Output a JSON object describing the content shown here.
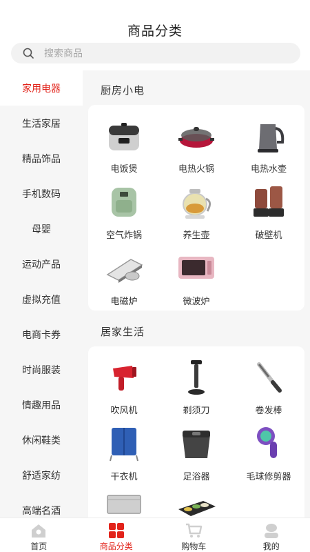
{
  "header": {
    "title": "商品分类"
  },
  "search": {
    "placeholder": "搜索商品"
  },
  "sidebar": {
    "items": [
      {
        "label": "家用电器",
        "active": true
      },
      {
        "label": "生活家居"
      },
      {
        "label": "精品饰品"
      },
      {
        "label": "手机数码"
      },
      {
        "label": "母婴"
      },
      {
        "label": "运动产品"
      },
      {
        "label": "虚拟充值"
      },
      {
        "label": "电商卡券"
      },
      {
        "label": "时尚服装"
      },
      {
        "label": "情趣用品"
      },
      {
        "label": "休闲鞋类"
      },
      {
        "label": "舒适家纺"
      },
      {
        "label": "高端名酒"
      }
    ]
  },
  "sections": [
    {
      "title": "厨房小电",
      "items": [
        {
          "label": "电饭煲",
          "icon": "rice-cooker-icon"
        },
        {
          "label": "电热火锅",
          "icon": "hotpot-icon"
        },
        {
          "label": "电热水壶",
          "icon": "kettle-icon"
        },
        {
          "label": "空气炸锅",
          "icon": "air-fryer-icon"
        },
        {
          "label": "养生壶",
          "icon": "health-pot-icon"
        },
        {
          "label": "破壁机",
          "icon": "blender-icon"
        },
        {
          "label": "电磁炉",
          "icon": "induction-cooker-icon"
        },
        {
          "label": "微波炉",
          "icon": "microwave-icon"
        }
      ]
    },
    {
      "title": "居家生活",
      "items": [
        {
          "label": "吹风机",
          "icon": "hair-dryer-icon"
        },
        {
          "label": "剃须刀",
          "icon": "razor-icon"
        },
        {
          "label": "卷发棒",
          "icon": "curling-iron-icon"
        },
        {
          "label": "干衣机",
          "icon": "clothes-dryer-icon"
        },
        {
          "label": "足浴器",
          "icon": "foot-bath-icon"
        },
        {
          "label": "毛球修剪器",
          "icon": "lint-trimmer-icon"
        },
        {
          "label": "",
          "icon": "steel-tray-icon"
        },
        {
          "label": "",
          "icon": "food-tray-icon"
        }
      ]
    }
  ],
  "tabbar": {
    "tabs": [
      {
        "label": "首页",
        "icon": "home-icon"
      },
      {
        "label": "商品分类",
        "icon": "category-icon",
        "active": true
      },
      {
        "label": "购物车",
        "icon": "cart-icon"
      },
      {
        "label": "我的",
        "icon": "profile-icon"
      }
    ]
  },
  "colors": {
    "accent": "#e2231a",
    "sidebar_bg": "#f6f6f6"
  }
}
